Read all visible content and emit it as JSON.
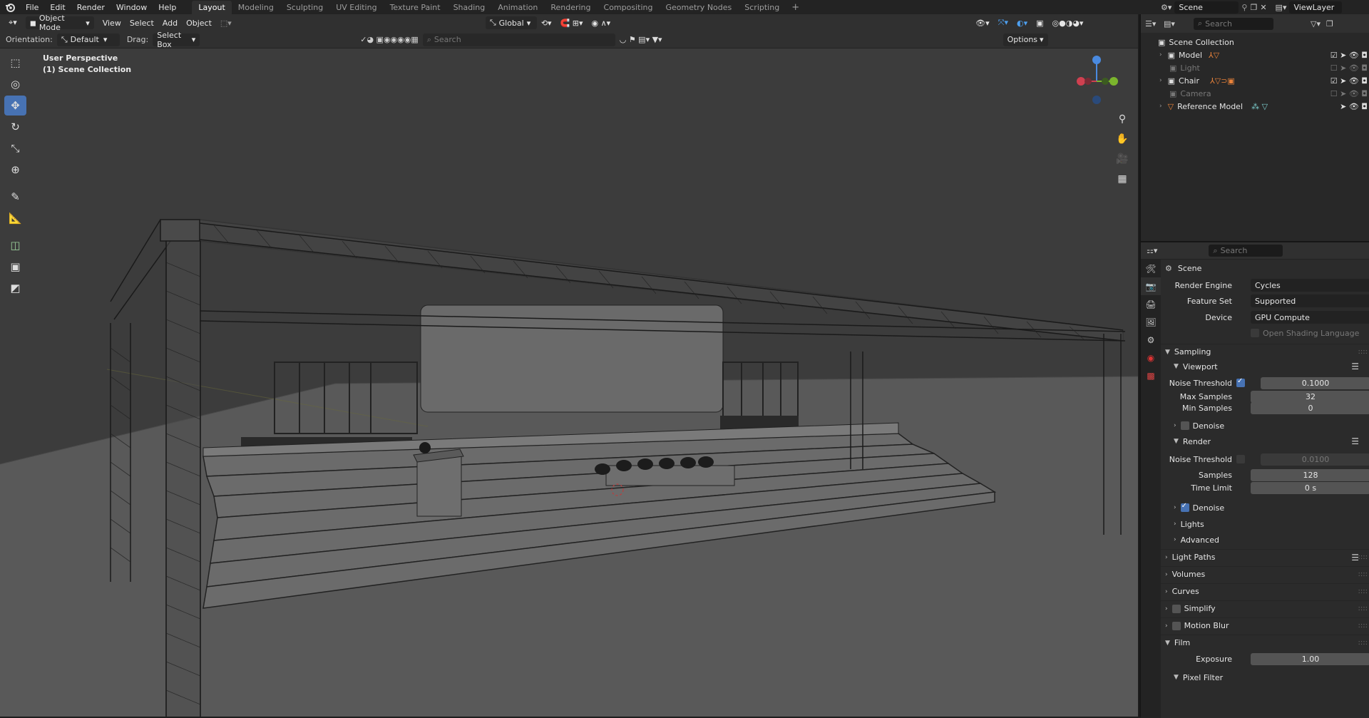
{
  "menu": [
    "File",
    "Edit",
    "Render",
    "Window",
    "Help"
  ],
  "workspaces": [
    "Layout",
    "Modeling",
    "Sculpting",
    "UV Editing",
    "Texture Paint",
    "Shading",
    "Animation",
    "Rendering",
    "Compositing",
    "Geometry Nodes",
    "Scripting"
  ],
  "active_workspace": "Layout",
  "scene_name": "Scene",
  "view_layer": "ViewLayer",
  "header": {
    "mode": "Object Mode",
    "menus": [
      "View",
      "Select",
      "Add",
      "Object"
    ],
    "transform": "Global"
  },
  "tool_header": {
    "orientation_label": "Orientation:",
    "orientation_value": "Default",
    "drag_label": "Drag:",
    "drag_value": "Select Box",
    "search_placeholder": "Search",
    "options": "Options"
  },
  "viewport": {
    "line1": "User Perspective",
    "line2": "(1) Scene Collection",
    "bg": "#3c3c3c",
    "floor": "#595959"
  },
  "outliner": {
    "search_placeholder": "Search",
    "root": "Scene Collection",
    "items": [
      {
        "name": "Model",
        "visible": true
      },
      {
        "name": "Light",
        "visible": false
      },
      {
        "name": "Chair",
        "visible": true
      },
      {
        "name": "Camera",
        "visible": false
      },
      {
        "name": "Reference Model",
        "visible": true
      }
    ]
  },
  "properties": {
    "search_placeholder": "Search",
    "context": "Scene",
    "render_engine_label": "Render Engine",
    "render_engine": "Cycles",
    "feature_set_label": "Feature Set",
    "feature_set": "Supported",
    "device_label": "Device",
    "device": "GPU Compute",
    "osl": "Open Shading Language",
    "sampling": "Sampling",
    "viewport": "Viewport",
    "noise_threshold_label": "Noise Threshold",
    "vp_noise_threshold": "0.1000",
    "max_samples_label": "Max Samples",
    "max_samples": "32",
    "min_samples_label": "Min Samples",
    "min_samples": "0",
    "denoise": "Denoise",
    "render": "Render",
    "r_noise_threshold": "0.0100",
    "samples_label": "Samples",
    "samples": "128",
    "time_limit_label": "Time Limit",
    "time_limit": "0 s",
    "lights": "Lights",
    "advanced": "Advanced",
    "light_paths": "Light Paths",
    "volumes": "Volumes",
    "curves": "Curves",
    "simplify": "Simplify",
    "motion_blur": "Motion Blur",
    "film": "Film",
    "exposure_label": "Exposure",
    "exposure": "1.00",
    "pixel_filter": "Pixel Filter"
  },
  "colors": {
    "accent": "#4772b3",
    "orange": "#e8823a"
  }
}
